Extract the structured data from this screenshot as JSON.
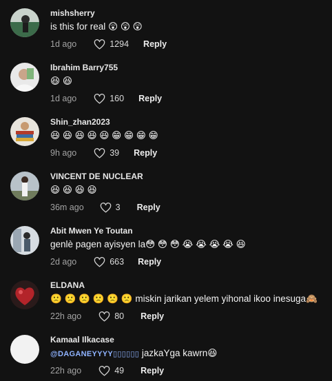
{
  "comments": [
    {
      "username": "mishsherry",
      "text": "is this for real 😲 😲 😲",
      "mention": "",
      "time": "1d ago",
      "likes": "1294",
      "reply_label": "Reply",
      "avatar_color": "#3c6b4a"
    },
    {
      "username": "Ibrahim Barry755",
      "text": "😆 😆",
      "mention": "",
      "time": "1d ago",
      "likes": "160",
      "reply_label": "Reply",
      "avatar_color": "#d9d9d9"
    },
    {
      "username": "Shin_zhan2023",
      "text": "😆 😆 😆 😆 😆 😁 😁 😁 😁",
      "mention": "",
      "time": "9h ago",
      "likes": "39",
      "reply_label": "Reply",
      "avatar_color": "#8a6d4a"
    },
    {
      "username": "VINCENT DE NUCLEAR",
      "text": "😆 😆 😆 😆",
      "mention": "",
      "time": "36m ago",
      "likes": "3",
      "reply_label": "Reply",
      "avatar_color": "#7a8896"
    },
    {
      "username": "Abit Mwen Ye Toutan",
      "text": "genlè pagen ayisyen la😳 😳 😳 😭 😭 😭 😭 😆",
      "mention": "",
      "time": "2d ago",
      "likes": "663",
      "reply_label": "Reply",
      "avatar_color": "#9aa7b3"
    },
    {
      "username": "ELDANA",
      "text": "🙁 🙁 🙁 🙁 🙁 🙁 miskin jarikan yelem yihonal ikoo inesuga🙈",
      "mention": "",
      "time": "22h ago",
      "likes": "80",
      "reply_label": "Reply",
      "avatar_color": "#b3242a"
    },
    {
      "username": "Kamaal Ilkacase",
      "text": " jazkaYga kawrn😆",
      "mention": "@DAGANEYYYY▯▯▯▯▯▯",
      "time": "22h ago",
      "likes": "49",
      "reply_label": "Reply",
      "avatar_color": "#f2f2f2"
    }
  ],
  "colors": {
    "background": "#121212",
    "username": "#e8e8e8",
    "meta": "#a9a9a9",
    "mention": "#8fb3ff"
  },
  "icons": {
    "like": "heart-outline-icon"
  }
}
